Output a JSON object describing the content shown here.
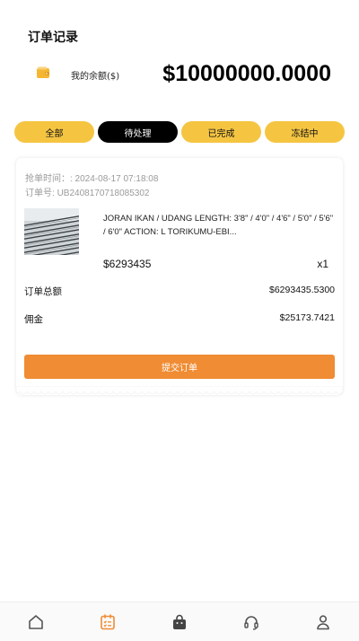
{
  "header": {
    "title": "订单记录"
  },
  "balance": {
    "label": "我的余额($)",
    "value": "$10000000.0000"
  },
  "tabs": [
    {
      "label": "全部"
    },
    {
      "label": "待处理"
    },
    {
      "label": "已完成"
    },
    {
      "label": "冻结中"
    }
  ],
  "order": {
    "time_label": "抢单时间：",
    "time_value": ": 2024-08-17 07:18:08",
    "order_no_label": "订单号: ",
    "order_no_value": "UB2408170718085302",
    "product_title": "JORAN IKAN / UDANG LENGTH: 3'8\" / 4'0\" / 4'6\" / 5'0\" / 5'6\" / 6'0\" ACTION: L TORIKUMU-EBI...",
    "price": "$6293435",
    "quantity": "x1",
    "total_label": "订单总额",
    "total_value": "$6293435.5300",
    "commission_label": "佣金",
    "commission_value": "$25173.7421",
    "submit_label": "提交订单"
  },
  "bottom_nav": [
    {
      "icon": "home-icon"
    },
    {
      "icon": "orders-icon",
      "active": true
    },
    {
      "icon": "shop-bag-icon"
    },
    {
      "icon": "headset-icon"
    },
    {
      "icon": "user-icon"
    }
  ],
  "colors": {
    "tab_yellow": "#f5c542",
    "tab_active": "#000000",
    "submit_orange": "#f08c33",
    "wallet_yellow": "#f5b731",
    "nav_active": "#f08c33",
    "nav_inactive": "#555555"
  }
}
